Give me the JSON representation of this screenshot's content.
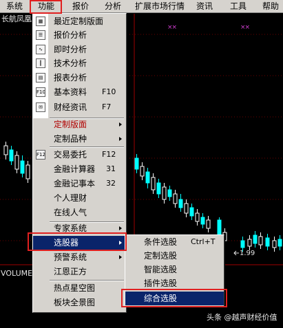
{
  "menubar": {
    "items": [
      "系统",
      "功能",
      "报价",
      "分析",
      "扩展市场行情",
      "资讯",
      "工具",
      "帮助"
    ]
  },
  "chart": {
    "stock_name": "长航凤凰",
    "markers": [
      "××",
      "××"
    ],
    "price_label": "1.99",
    "volume_label": "VOLUME"
  },
  "menu": {
    "items": [
      {
        "label": "最近定制版面",
        "icon": "layout-icon"
      },
      {
        "label": "报价分析",
        "icon": "quote-icon"
      },
      {
        "label": "即时分析",
        "icon": "realtime-icon"
      },
      {
        "label": "技术分析",
        "icon": "candlestick-icon"
      },
      {
        "label": "报表分析",
        "icon": "report-icon"
      },
      {
        "label": "基本资料",
        "shortcut": "F10",
        "icon": "f10-icon",
        "icon_text": "F10"
      },
      {
        "label": "财经资讯",
        "shortcut": "F7",
        "icon": "news-icon"
      },
      {
        "label": "定制版面",
        "submenu": true
      },
      {
        "label": "定制品种",
        "submenu": true
      },
      {
        "label": "交易委托",
        "shortcut": "F12",
        "icon": "f12-icon",
        "icon_text": "F12"
      },
      {
        "label": "金融计算器",
        "shortcut": "31"
      },
      {
        "label": "金融记事本",
        "shortcut": "32"
      },
      {
        "label": "个人理财"
      },
      {
        "label": "在线人气"
      },
      {
        "label": "专家系统",
        "submenu": true
      },
      {
        "label": "选股器",
        "submenu": true
      },
      {
        "label": "预警系统",
        "submenu": true
      },
      {
        "label": "江恩正方"
      },
      {
        "label": "热点星空图"
      },
      {
        "label": "板块全景图"
      }
    ]
  },
  "submenu": {
    "items": [
      {
        "label": "条件选股",
        "shortcut": "Ctrl+T"
      },
      {
        "label": "定制选股"
      },
      {
        "label": "智能选股"
      },
      {
        "label": "插件选股"
      },
      {
        "label": "综合选股"
      }
    ]
  },
  "watermark": "头条 @越声财经价值",
  "colors": {
    "menu_bg": "#d6d3ce",
    "selection": "#0a246a",
    "highlight_red": "#e02020",
    "candle_up": "#ffffff",
    "candle_down": "#00ffff",
    "annotation_arrow": "#d040d0"
  }
}
